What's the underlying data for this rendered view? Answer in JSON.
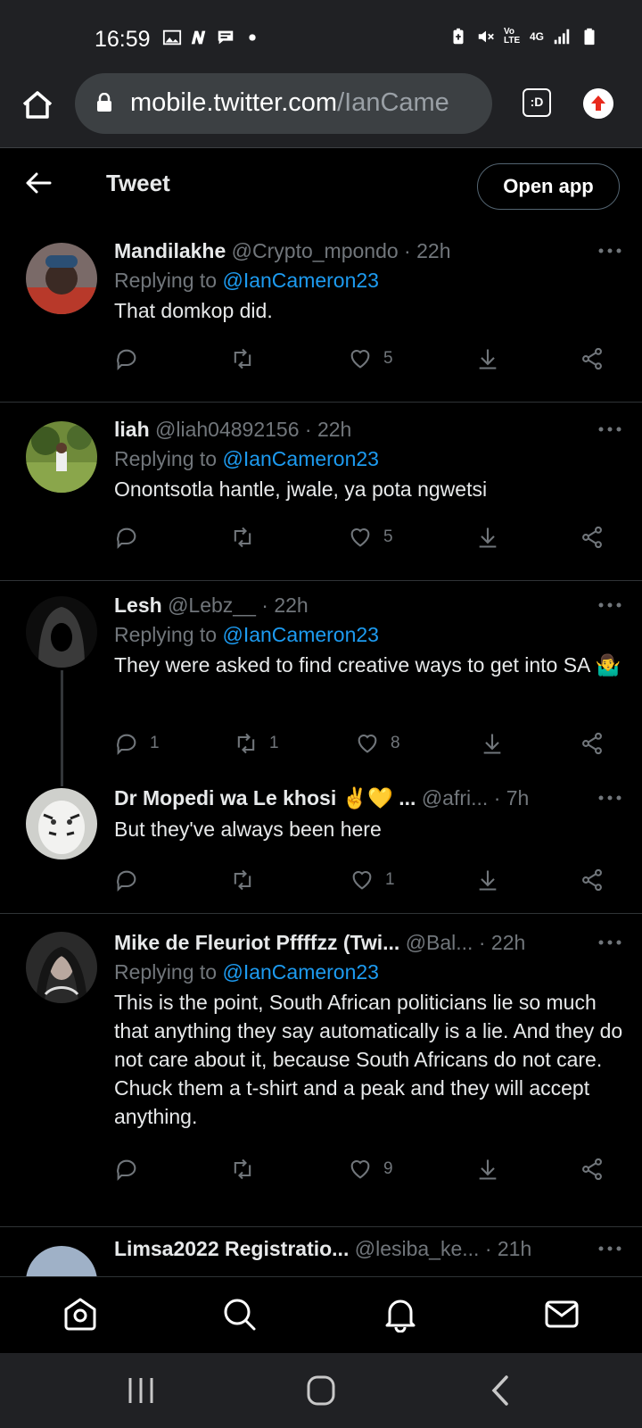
{
  "status_bar": {
    "time": "16:59",
    "left_icons": [
      "image-icon",
      "n-app-icon",
      "message-icon",
      "dot-icon"
    ],
    "right_icons": [
      "battery-saver-icon",
      "mute-icon",
      "volte-icon",
      "4g-icon",
      "signal-icon",
      "battery-icon"
    ],
    "volte_label": "Vo LTE",
    "network_label": "4G"
  },
  "browser": {
    "url_domain": "mobile.twitter.com",
    "url_path": "/IanCame",
    "tabs_label": ":D"
  },
  "header": {
    "title": "Tweet",
    "open_app_label": "Open app"
  },
  "tweets": [
    {
      "name": "Mandilakhe",
      "handle": "@Crypto_mpondo",
      "sep": " · ",
      "time": "22h",
      "replying_prefix": "Replying to ",
      "replying_to": "@IanCameron23",
      "text": "That domkop did.",
      "replies": "",
      "retweets": "",
      "likes": "5"
    },
    {
      "name": "liah",
      "handle": "@liah04892156",
      "sep": " · ",
      "time": "22h",
      "replying_prefix": "Replying to ",
      "replying_to": "@IanCameron23",
      "text": "Onontsotla hantle, jwale, ya pota ngwetsi",
      "replies": "",
      "retweets": "",
      "likes": "5"
    },
    {
      "name": "Lesh",
      "handle": "@Lebz__",
      "sep": " · ",
      "time": "22h",
      "replying_prefix": "Replying to ",
      "replying_to": "@IanCameron23",
      "text": "They were asked to find creative ways to get into SA 🤷‍♂️",
      "replies": "1",
      "retweets": "1",
      "likes": "8"
    },
    {
      "name": "Dr Mopedi wa Le khosi ✌️💛 ...",
      "handle": "@afri...",
      "sep": " · ",
      "time": "7h",
      "text": "But they've always been here",
      "replies": "",
      "retweets": "",
      "likes": "1"
    },
    {
      "name": "Mike de Fleuriot Pffffzz (Twi...",
      "handle": "@Bal...",
      "sep": " · ",
      "time": "22h",
      "replying_prefix": "Replying to ",
      "replying_to": "@IanCameron23",
      "text": "This is the point, South African politicians lie so much that anything they say automatically is a lie. And they do not care about it, because South Africans do not care. Chuck them a t-shirt and a peak and they will accept anything.",
      "replies": "",
      "retweets": "",
      "likes": "9"
    },
    {
      "name": "Limsa2022 Registratio...",
      "handle": "@lesiba_ke...",
      "sep": " · ",
      "time": "21h"
    }
  ],
  "bottom_nav": [
    "home-icon",
    "search-icon",
    "notifications-icon",
    "messages-icon"
  ],
  "system_nav": [
    "recents-icon",
    "home-circle-icon",
    "back-chevron-icon"
  ],
  "colors": {
    "background": "#000000",
    "browser_chrome": "#202124",
    "accent_link": "#1d9bf0",
    "muted_text": "#71767b",
    "primary_text": "#e7e9ea"
  }
}
